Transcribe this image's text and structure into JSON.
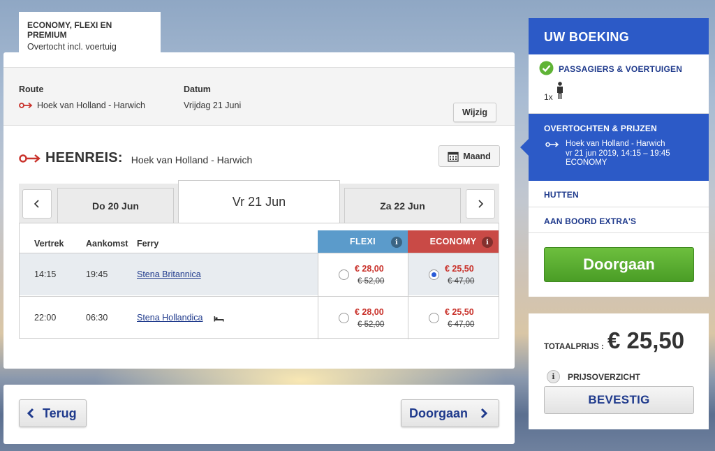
{
  "fare_tab": {
    "title": "ECONOMY, FLEXI EN PREMIUM",
    "subtitle": "Overtocht incl. voertuig"
  },
  "summary": {
    "route_label": "Route",
    "route_value": "Hoek van Holland - Harwich",
    "date_label": "Datum",
    "date_value": "Vrijdag 21 Juni",
    "change_button": "Wijzig"
  },
  "outbound": {
    "title": "HEENREIS:",
    "route": "Hoek van Holland - Harwich",
    "month_button": "Maand"
  },
  "dates": {
    "prev": "Do 20 Jun",
    "current": "Vr 21 Jun",
    "next": "Za 22 Jun"
  },
  "table": {
    "headers": {
      "departure": "Vertrek",
      "arrival": "Aankomst",
      "ferry": "Ferry"
    },
    "fares": {
      "flexi": {
        "label": "FLEXI",
        "color": "#5b9bcb"
      },
      "economy": {
        "label": "ECONOMY",
        "color": "#c94a46"
      }
    },
    "rows": [
      {
        "departure": "14:15",
        "arrival": "19:45",
        "ferry": "Stena Britannica",
        "flexi_price": "€ 28,00",
        "flexi_old": "€ 52,00",
        "economy_price": "€ 25,50",
        "economy_old": "€ 47,00",
        "selected": "economy"
      },
      {
        "departure": "22:00",
        "arrival": "06:30",
        "ferry": "Stena Hollandica",
        "flexi_price": "€ 28,00",
        "flexi_old": "€ 52,00",
        "economy_price": "€ 25,50",
        "economy_old": "€ 47,00",
        "selected": "none",
        "icon": "bed-icon"
      }
    ]
  },
  "nav": {
    "back": "Terug",
    "continue": "Doorgaan"
  },
  "booking": {
    "title": "UW BOEKING",
    "passengers": {
      "title": "PASSAGIERS & VOERTUIGEN",
      "count": "1x",
      "status": "completed"
    },
    "crossings": {
      "title": "OVERTOCHTEN & PRIJZEN",
      "route": "Hoek van Holland - Harwich",
      "datetime": "vr 21 jun 2019, 14:15 – 19:45",
      "fare": "ECONOMY"
    },
    "cabins": "HUTTEN",
    "extras": "AAN BOORD EXTRA'S",
    "continue_button": "Doorgaan"
  },
  "total": {
    "label": "TOTAALPRIJS :",
    "amount": "€ 25,50",
    "overview": "PRIJSOVERZICHT",
    "confirm": "BEVESTIG"
  },
  "colors": {
    "brand_blue": "#2c5ac7",
    "link_blue": "#1f3a8c",
    "price_red": "#c9322b",
    "accent_green": "#4a9d26"
  }
}
